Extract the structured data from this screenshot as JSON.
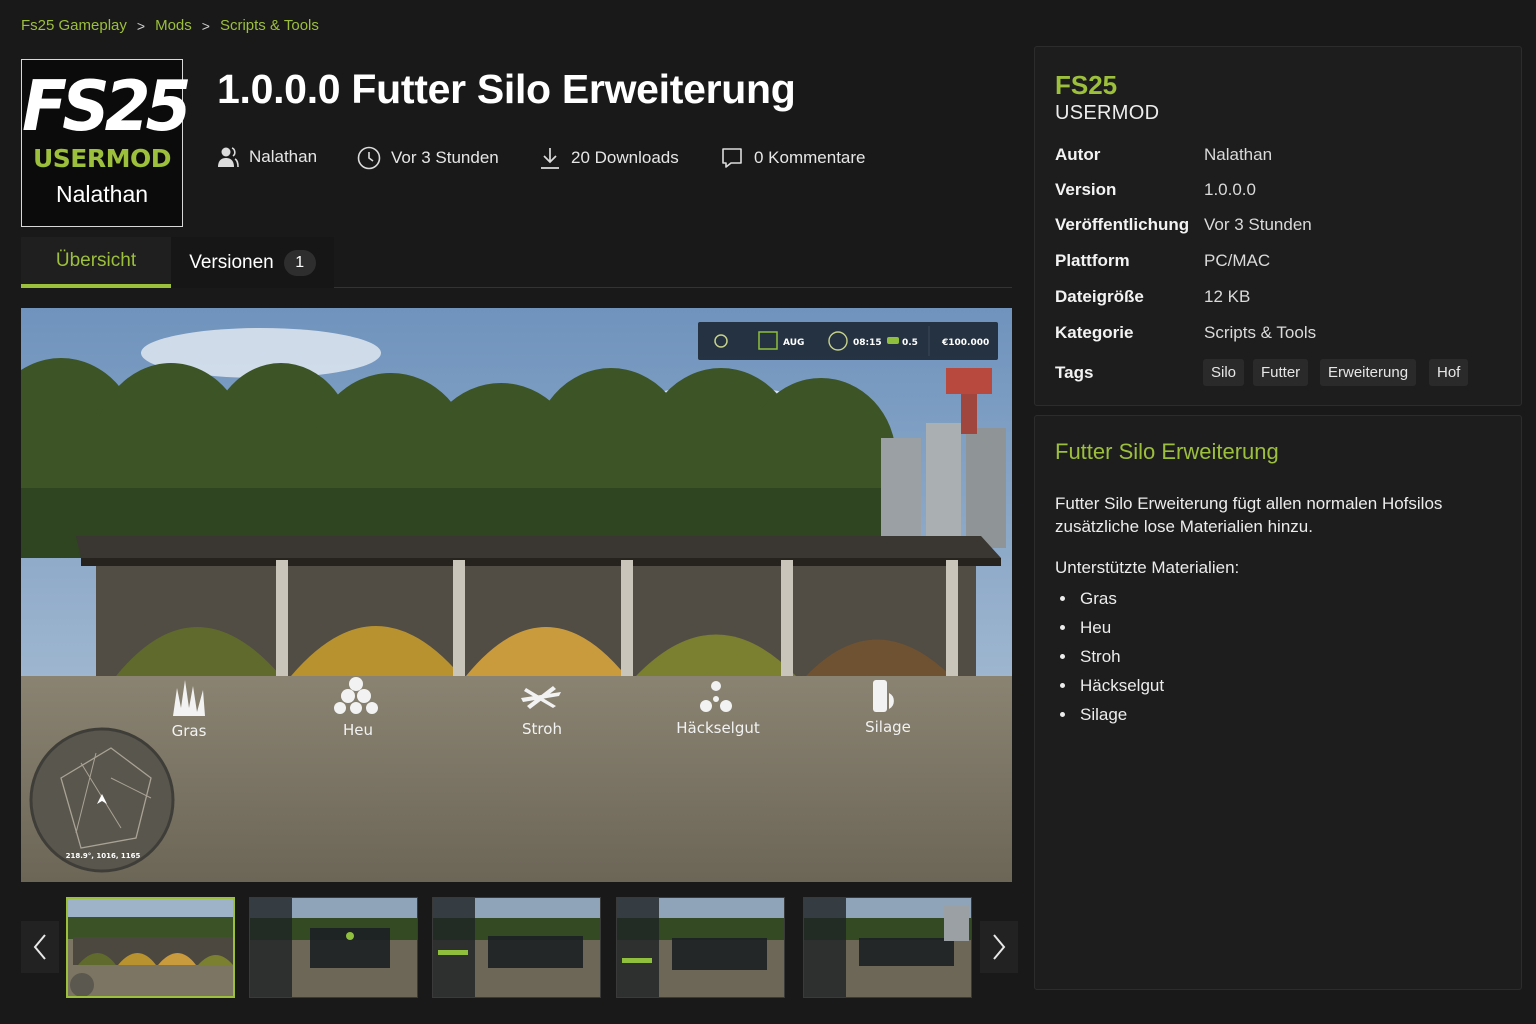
{
  "breadcrumb": {
    "items": [
      "Fs25 Gameplay",
      "Mods",
      "Scripts & Tools"
    ],
    "separator": ">"
  },
  "logo": {
    "game": "FS25",
    "type": "USERMOD",
    "author": "Nalathan"
  },
  "title": "1.0.0.0 Futter Silo Erweiterung",
  "meta": {
    "author": "Nalathan",
    "time": "Vor 3 Stunden",
    "downloads": "20 Downloads",
    "comments": "0 Kommentare"
  },
  "tabs": {
    "overview": "Übersicht",
    "versions": "Versionen",
    "versions_count": "1"
  },
  "screenshot": {
    "hud": {
      "month": "AUG",
      "time": "08:15",
      "speed": "0.5",
      "money": "€100.000"
    },
    "labels": [
      "Gras",
      "Heu",
      "Stroh",
      "Häckselgut",
      "Silage"
    ],
    "minimap_coords": "218.9°, 1016, 1165"
  },
  "thumbnails": {
    "count": 5,
    "active_index": 0
  },
  "info": {
    "game": "FS25",
    "type": "USERMOD",
    "rows": [
      {
        "key": "Autor",
        "value": "Nalathan"
      },
      {
        "key": "Version",
        "value": "1.0.0.0"
      },
      {
        "key": "Veröffentlichung",
        "value": "Vor 3 Stunden"
      },
      {
        "key": "Plattform",
        "value": "PC/MAC"
      },
      {
        "key": "Dateigröße",
        "value": "12 KB"
      },
      {
        "key": "Kategorie",
        "value": "Scripts & Tools"
      }
    ],
    "tags_label": "Tags",
    "tags": [
      "Silo",
      "Futter",
      "Erweiterung",
      "Hof"
    ]
  },
  "description": {
    "title": "Futter Silo Erweiterung",
    "text": "Futter Silo Erweiterung fügt allen normalen Hofsilos zusätzliche lose Materialien hinzu.",
    "materials_heading": "Unterstützte Materialien:",
    "materials": [
      "Gras",
      "Heu",
      "Stroh",
      "Häckselgut",
      "Silage"
    ]
  },
  "colors": {
    "accent": "#9cbf3c",
    "background": "#191919",
    "panel": "#1d1d1d"
  },
  "icons": [
    "user-icon",
    "clock-icon",
    "download-icon",
    "comment-icon",
    "chevron-left-icon",
    "chevron-right-icon"
  ]
}
